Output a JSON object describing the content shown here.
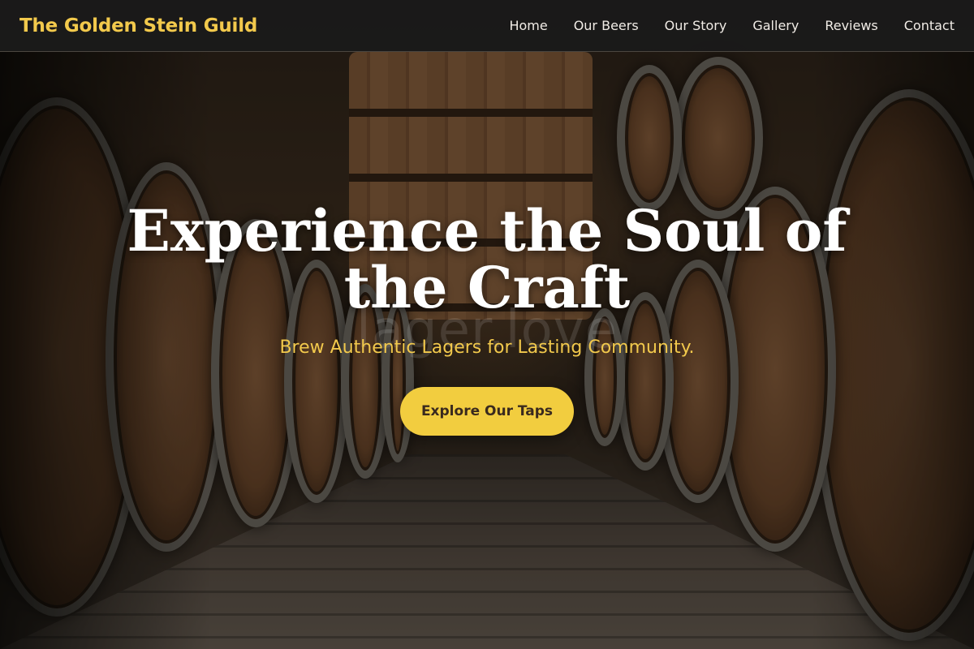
{
  "header": {
    "brand": "The Golden Stein Guild",
    "nav": [
      "Home",
      "Our Beers",
      "Our Story",
      "Gallery",
      "Reviews",
      "Contact"
    ]
  },
  "hero": {
    "headline": "Experience the Soul of the Craft",
    "watermark": "lager.love",
    "tagline": "Brew Authentic Lagers for Lasting Community.",
    "cta_label": "Explore Our Taps"
  },
  "colors": {
    "accent": "#f2c94c",
    "cta_bg": "#f2cd3f",
    "header_bg": "#1a1a1a"
  }
}
